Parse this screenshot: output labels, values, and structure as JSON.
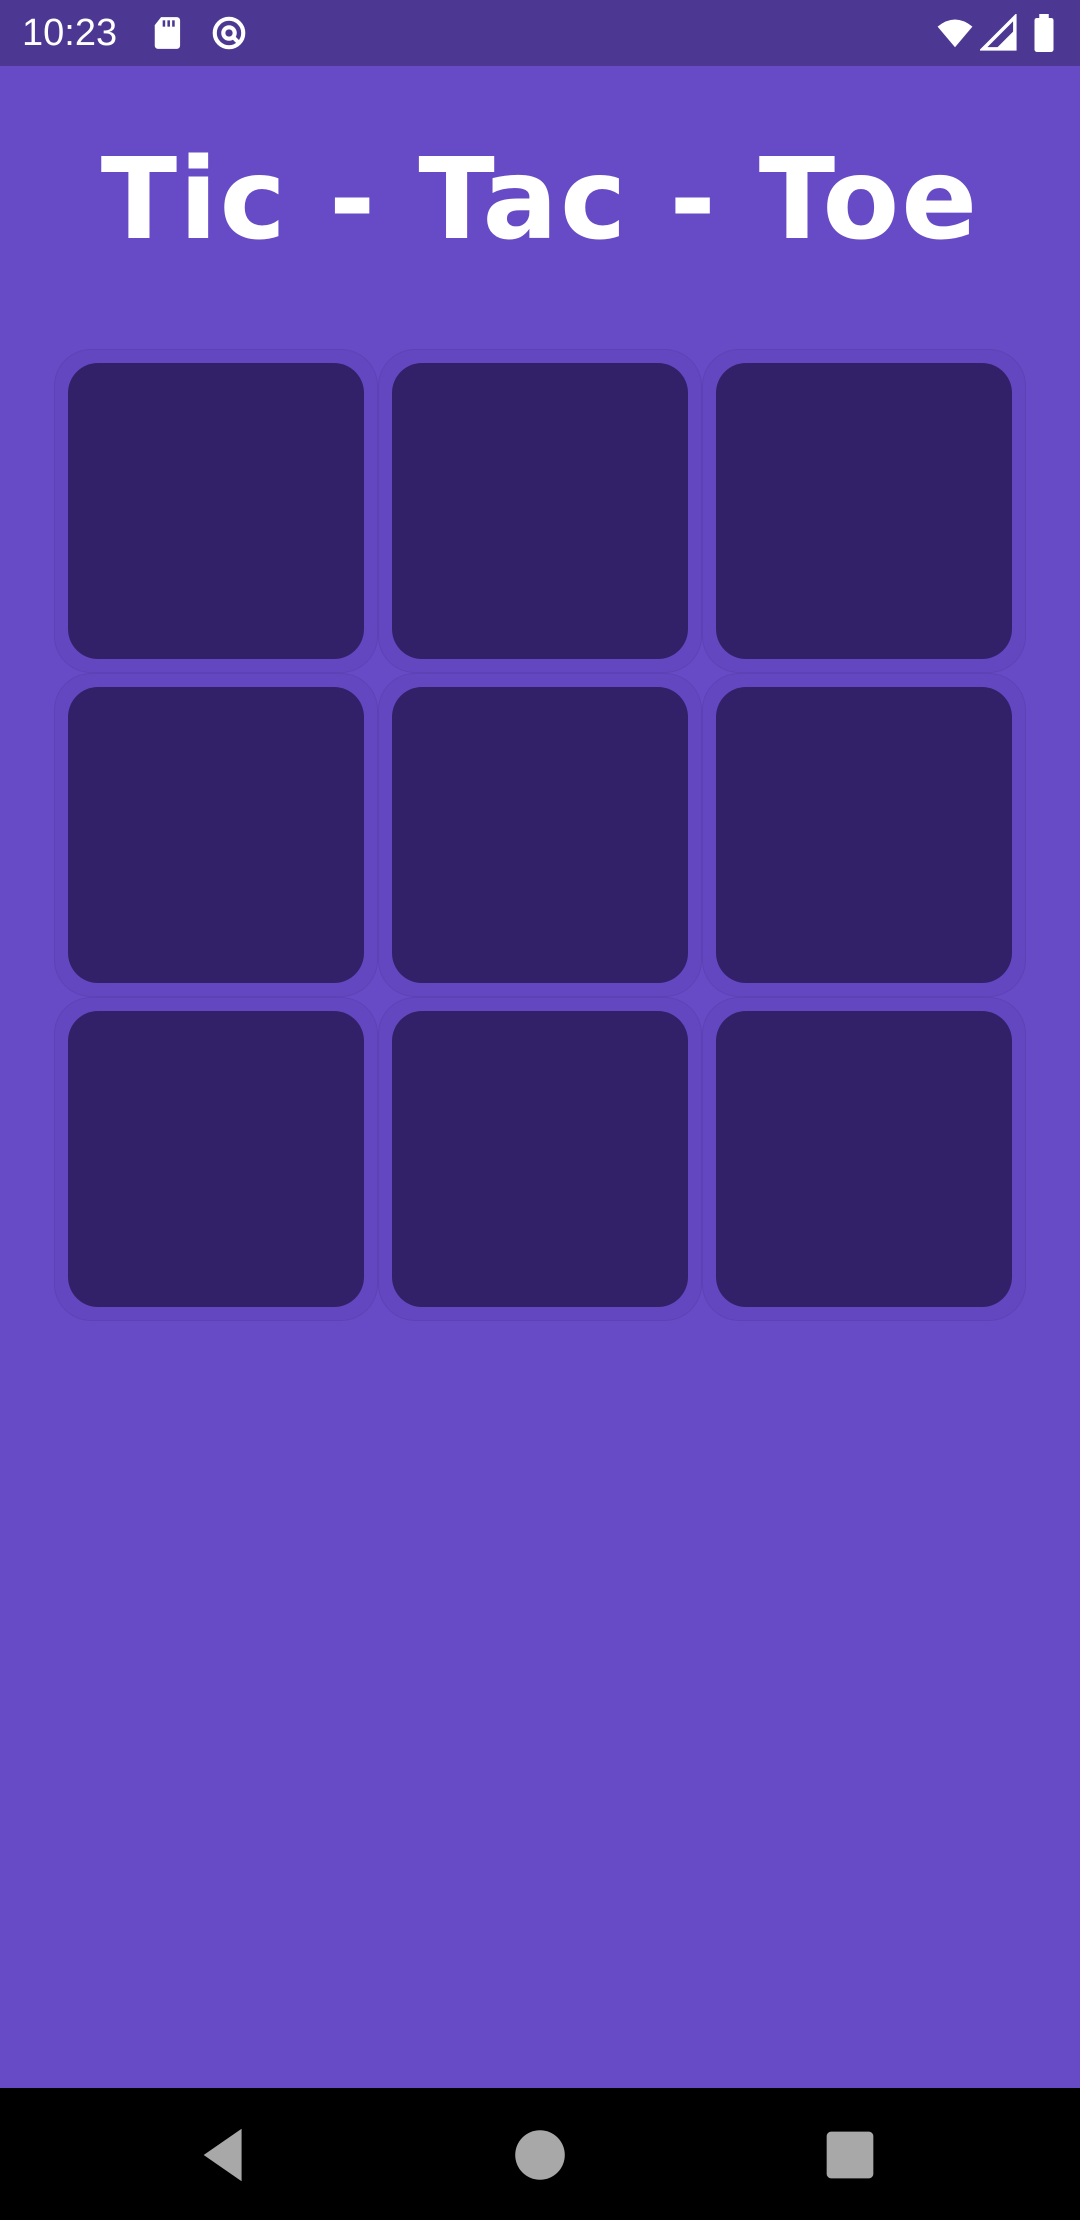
{
  "status_bar": {
    "time": "10:23",
    "left_icons": [
      "sd-card-icon",
      "sync-icon"
    ],
    "right_icons": [
      "wifi-icon",
      "cellular-signal-icon",
      "battery-icon"
    ],
    "background": "#4C3892"
  },
  "app": {
    "title": "Tic - Tac - Toe",
    "background": "#674BC6"
  },
  "board": {
    "rows": 3,
    "cols": 3,
    "cells": [
      "",
      "",
      "",
      "",
      "",
      "",
      "",
      "",
      ""
    ],
    "cell_color": "#322168"
  },
  "nav_bar": {
    "buttons": [
      "back-icon",
      "home-icon",
      "recents-icon"
    ]
  }
}
